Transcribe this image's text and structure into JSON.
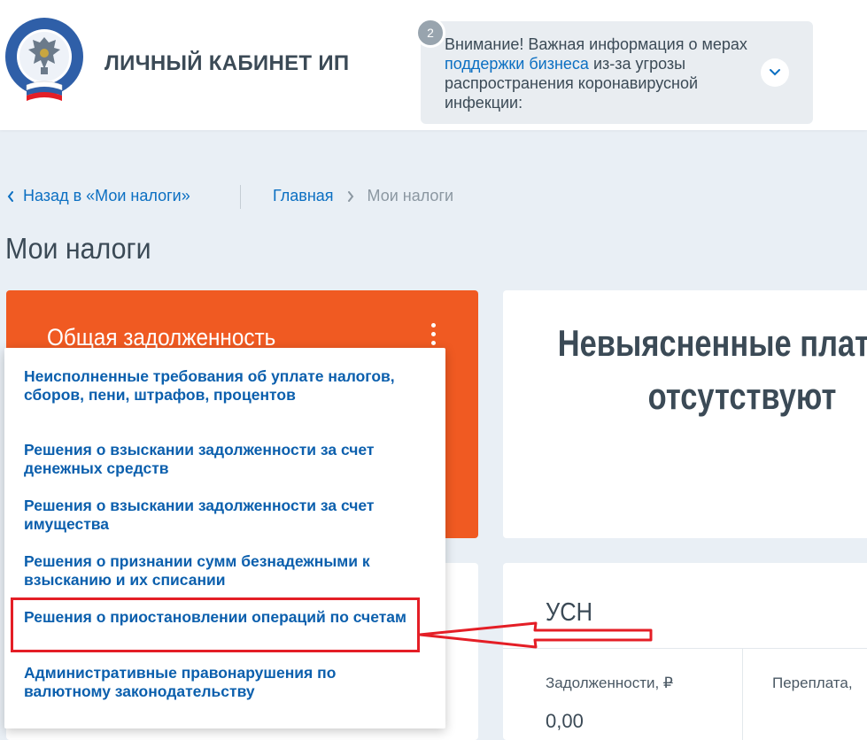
{
  "header": {
    "site_title": "ЛИЧНЫЙ КАБИНЕТ ИП",
    "logo_alt": "ФЕДЕРАЛЬНАЯ НАЛОГОВАЯ СЛУЖБА",
    "notice": {
      "badge_count": "2",
      "text_before": "Внимание! Важная информация о мерах ",
      "link_text": "поддержки бизнеса",
      "text_after": " из-за угрозы распространения коронавирусной инфекции:",
      "toggle_icon": "chevron-down-icon"
    }
  },
  "nav": {
    "back_label": "Назад в «Мои налоги»",
    "breadcrumb": {
      "home": "Главная",
      "current": "Мои налоги"
    }
  },
  "page": {
    "title": "Мои налоги"
  },
  "debt_card": {
    "title": "Общая задолженность",
    "menu_icon": "kebab-icon"
  },
  "dropdown": {
    "items": [
      {
        "label": "Неисполненные требования об уплате налогов, сборов, пени, штрафов, процентов"
      },
      {
        "label": "Решения о взыскании задолженности за счет денежных средств"
      },
      {
        "label": "Решения о взыскании задолженности за счет имущества"
      },
      {
        "label": "Решения о признании сумм безнадежными к взысканию и их списании"
      },
      {
        "label": "Решения о приостановлении операций по счетам"
      },
      {
        "label": "Административные правонарушения по валютному законодательству"
      }
    ],
    "highlighted_index": 4
  },
  "unclear_card": {
    "title_line1": "Невыясненные платежи",
    "title_line2": "отсутствуют"
  },
  "usn_card": {
    "title": "УСН",
    "debt_label": "Задолженности,",
    "overpay_label": "Переплата,",
    "currency": "₽",
    "debt_value": "0,00"
  },
  "colors": {
    "accent_orange": "#f05a22",
    "link_blue": "#0b6fc2",
    "menu_blue": "#0b5fad",
    "annotation_red": "#e41e26",
    "page_bg": "#e9eff5"
  }
}
